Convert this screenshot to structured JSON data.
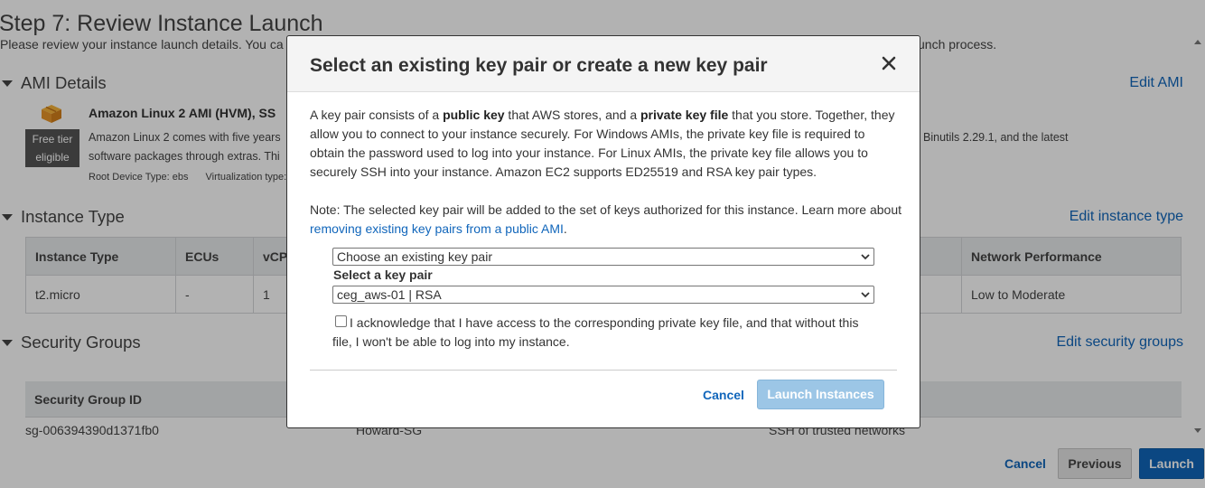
{
  "page": {
    "title": "Step 7: Review Instance Launch",
    "description_start": "Please review your instance launch details. You ca",
    "description_end": "unch process."
  },
  "ami": {
    "section_title": "AMI Details",
    "edit_link": "Edit AMI",
    "badge_line1": "Free tier",
    "badge_line2": "eligible",
    "name": "Amazon Linux 2 AMI (HVM), SS",
    "desc_line1": "Amazon Linux 2 comes with five years",
    "desc_line1_end": "Binutils 2.29.1, and the latest",
    "desc_line2": "software packages through extras. Thi",
    "root_device": "Root Device Type: ebs",
    "virtualization": "Virtualization type:"
  },
  "instance_type": {
    "section_title": "Instance Type",
    "edit_link": "Edit instance type",
    "headers": [
      "Instance Type",
      "ECUs",
      "vCP",
      "Network Performance"
    ],
    "row": [
      "t2.micro",
      "-",
      "1",
      "Low to Moderate"
    ]
  },
  "security_groups": {
    "section_title": "Security Groups",
    "edit_link": "Edit security groups",
    "header_id": "Security Group ID",
    "row_id": "sg-006394390d1371fb0",
    "row_name": "Howard-SG",
    "row_desc": "SSH of trusted networks"
  },
  "footer": {
    "cancel": "Cancel",
    "previous": "Previous",
    "launch": "Launch"
  },
  "modal": {
    "title": "Select an existing key pair or create a new key pair",
    "para_1": "A key pair consists of a ",
    "para_bold_1": "public key",
    "para_2": " that AWS stores, and a ",
    "para_bold_2": "private key file",
    "para_3": " that you store. Together, they allow you to connect to your instance securely. For Windows AMIs, the private key file is required to obtain the password used to log into your instance. For Linux AMIs, the private key file allows you to securely SSH into your instance. Amazon EC2 supports ED25519 and RSA key pair types.",
    "note_text": "Note: The selected key pair will be added to the set of keys authorized for this instance. Learn more about ",
    "note_link": "removing existing key pairs from a public AMI",
    "note_end": ".",
    "choice_select": "Choose an existing key pair",
    "select_label": "Select a key pair",
    "key_select": "ceg_aws-01 | RSA",
    "acknowledge": "I acknowledge that I have access to the corresponding private key file, and that without this file, I won't be able to log into my instance.",
    "cancel": "Cancel",
    "launch": "Launch Instances"
  },
  "colors": {
    "link": "#1166bb",
    "primary_button": "#1166bb",
    "disabled_button": "#9cc6e6",
    "free_tier_badge": "#555555"
  },
  "icons": [
    "ami-box-icon",
    "caret-down-icon",
    "close-icon",
    "chevron-down-icon"
  ]
}
